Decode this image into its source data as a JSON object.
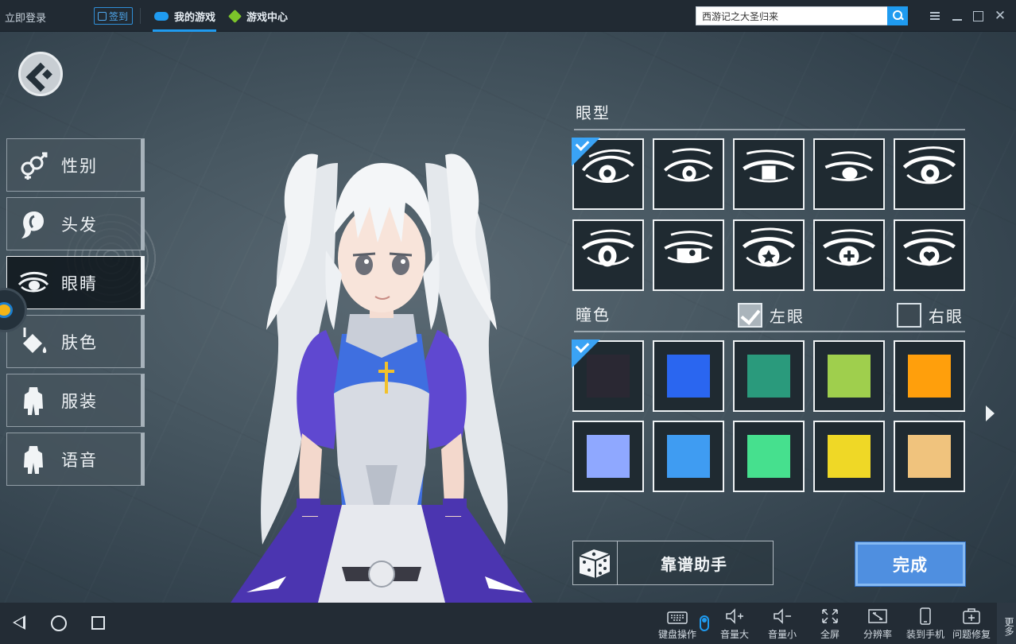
{
  "topbar": {
    "login_label": "立即登录",
    "sign_label": "签到",
    "tabs": [
      {
        "label": "我的游戏",
        "active": true,
        "icon": "gamepad-icon"
      },
      {
        "label": "游戏中心",
        "active": false,
        "icon": "cube-icon"
      }
    ],
    "search": {
      "value": "西游记之大圣归来"
    },
    "colors": {
      "accent": "#1f9bf0"
    }
  },
  "sidebar": {
    "items": [
      {
        "label": "性别",
        "icon": "gender-icon",
        "active": false
      },
      {
        "label": "头发",
        "icon": "hair-icon",
        "active": false
      },
      {
        "label": "眼睛",
        "icon": "eye-icon",
        "active": true
      },
      {
        "label": "肤色",
        "icon": "paint-bucket-icon",
        "active": false
      },
      {
        "label": "服装",
        "icon": "outfit-icon",
        "active": false
      },
      {
        "label": "语音",
        "icon": "voice-icon",
        "active": false
      }
    ]
  },
  "panel": {
    "eye_shape_title": "眼型",
    "eye_shapes_selected": 1,
    "pupil_color_title": "瞳色",
    "left_eye_label": "左眼",
    "left_eye_checked": true,
    "right_eye_label": "右眼",
    "right_eye_checked": false,
    "pupil_colors": [
      "#2a2833",
      "#2a66f0",
      "#2a9a7c",
      "#9fcf4d",
      "#ff9f0c",
      "#8fa8ff",
      "#3f9cf2",
      "#46e08e",
      "#efd826",
      "#f0c37d"
    ],
    "pupil_color_selected": 1,
    "helper_label": "靠谱助手",
    "done_label": "完成"
  },
  "bottombar": {
    "tools": [
      {
        "label": "键盘操作",
        "icon": "keyboard-icon"
      },
      {
        "label": "音量大",
        "icon": "volume-up-icon"
      },
      {
        "label": "音量小",
        "icon": "volume-down-icon"
      },
      {
        "label": "全屏",
        "icon": "fullscreen-icon"
      },
      {
        "label": "分辨率",
        "icon": "resolution-icon"
      },
      {
        "label": "装到手机",
        "icon": "phone-icon"
      },
      {
        "label": "问题修复",
        "icon": "repair-icon"
      }
    ],
    "more_label": "更多"
  }
}
